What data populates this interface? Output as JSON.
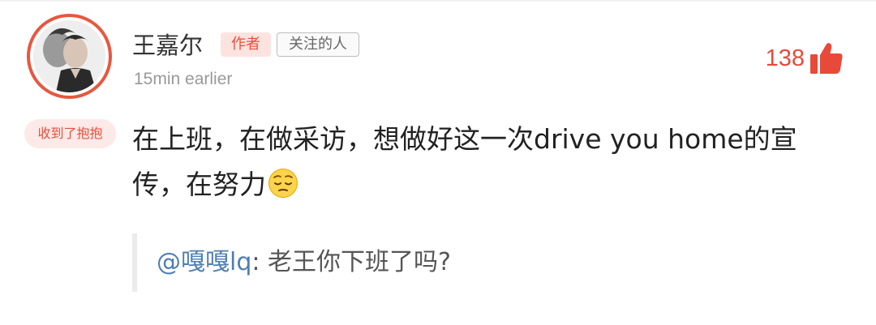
{
  "comment": {
    "author_name": "王嘉尔",
    "author_badge": "作者",
    "follow_badge": "关注的人",
    "timestamp": "15min earlier",
    "gift_badge": "收到了抱抱",
    "like_count": "138",
    "text": "在上班，在做采访，想做好这一次drive you home的宣传，在努力",
    "emoji": "pensive-face-emoji"
  },
  "reply": {
    "user": "@嘎嘎lq",
    "separator": ":",
    "text": "老王你下班了吗?"
  },
  "colors": {
    "accent_red": "#e84a3a",
    "badge_bg": "#fde3e0",
    "link_blue": "#4f7fb0",
    "avatar_ring": "#e8573f"
  },
  "icons": {
    "like": "thumbs-up-icon",
    "avatar": "user-avatar"
  }
}
